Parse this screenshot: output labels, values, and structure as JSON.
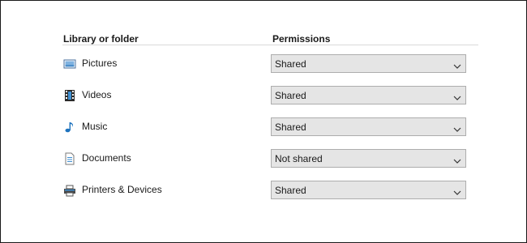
{
  "headers": {
    "library": "Library or folder",
    "permissions": "Permissions"
  },
  "rows": [
    {
      "label": "Pictures",
      "icon": "pictures-icon",
      "permission": "Shared"
    },
    {
      "label": "Videos",
      "icon": "videos-icon",
      "permission": "Shared"
    },
    {
      "label": "Music",
      "icon": "music-icon",
      "permission": "Shared"
    },
    {
      "label": "Documents",
      "icon": "documents-icon",
      "permission": "Not shared"
    },
    {
      "label": "Printers & Devices",
      "icon": "printer-icon",
      "permission": "Shared"
    }
  ],
  "colors": {
    "dropdown_bg": "#e5e5e5",
    "dropdown_border": "#adadad",
    "icon_blue": "#1e73be"
  }
}
